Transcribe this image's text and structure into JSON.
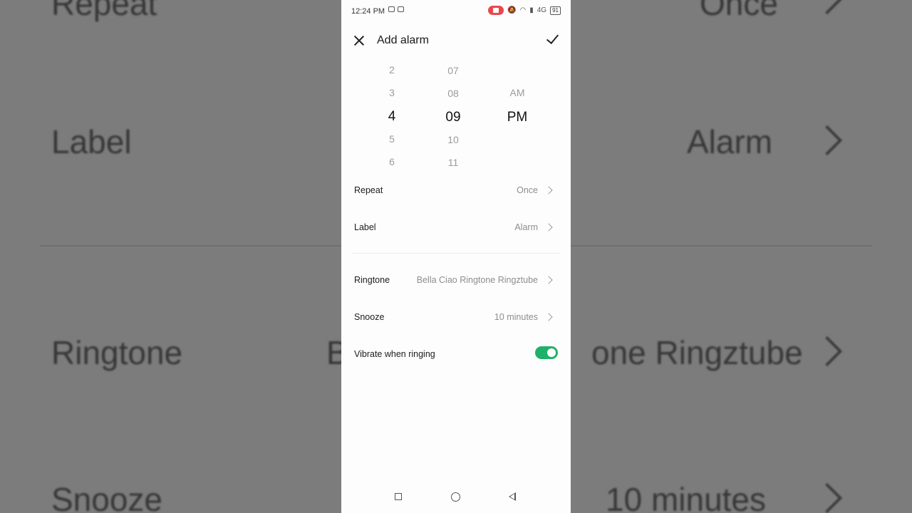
{
  "status_bar": {
    "time": "12:24 PM",
    "network": "4G",
    "battery": "91"
  },
  "header": {
    "title": "Add alarm"
  },
  "time_picker": {
    "hours": [
      "2",
      "3",
      "4",
      "5",
      "6"
    ],
    "minutes": [
      "07",
      "08",
      "09",
      "10",
      "11"
    ],
    "periods": [
      "AM",
      "PM"
    ],
    "selected_hour": "4",
    "selected_minute": "09",
    "selected_period": "PM"
  },
  "settings": {
    "repeat": {
      "label": "Repeat",
      "value": "Once"
    },
    "label": {
      "label": "Label",
      "value": "Alarm"
    },
    "ringtone": {
      "label": "Ringtone",
      "value": "Bella Ciao Ringtone Ringztube"
    },
    "snooze": {
      "label": "Snooze",
      "value": "10 minutes"
    },
    "vibrate": {
      "label": "Vibrate when ringing",
      "enabled": true
    }
  },
  "background": {
    "repeat_label": "Repeat",
    "repeat_value": "Once",
    "label_label": "Label",
    "label_value": "Alarm",
    "ringtone_label": "Ringtone",
    "ringtone_value_left": "B",
    "ringtone_value_right": "one Ringztube",
    "snooze_label": "Snooze",
    "snooze_value": "10 minutes"
  },
  "colors": {
    "toggle_on": "#1fb16a",
    "record_indicator": "#e9484b"
  }
}
